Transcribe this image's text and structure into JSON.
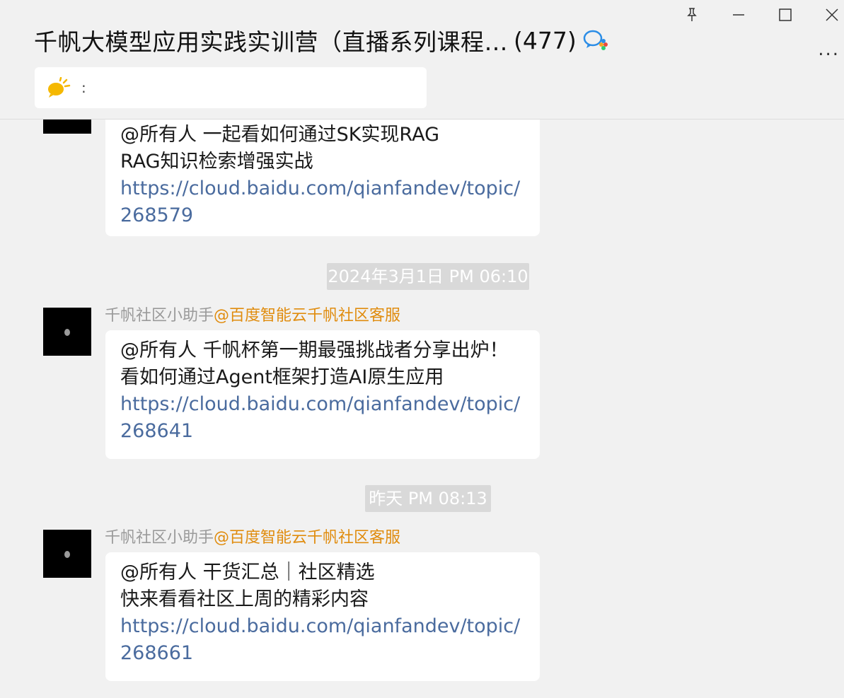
{
  "window": {
    "title": "千帆大模型应用实践实训营（直播系列课程…",
    "member_count": "(477)",
    "controls": [
      "pin-icon",
      "minimize-icon",
      "maximize-icon",
      "close-icon"
    ],
    "more_label": "..."
  },
  "notice": {
    "icon": "announcement-icon",
    "text": ":"
  },
  "messages": [
    {
      "lines": [
        "@所有人 一起看如何通过SK实现RAG",
        "RAG知识检索增强实战"
      ],
      "link": [
        "https://cloud.baidu.com/qianfandev/topic/",
        "268579"
      ]
    },
    {
      "timestamp": "2024年3月1日 PM 06:10",
      "sender": "千帆社区小助手",
      "sender_org": "@百度智能云千帆社区客服",
      "lines": [
        "@所有人 千帆杯第一期最强挑战者分享出炉！",
        "看如何通过Agent框架打造AI原生应用"
      ],
      "link": [
        "https://cloud.baidu.com/qianfandev/topic/",
        "268641"
      ]
    },
    {
      "timestamp": "昨天 PM 08:13",
      "sender": "千帆社区小助手",
      "sender_org": "@百度智能云千帆社区客服",
      "lines": [
        "@所有人 干货汇总｜社区精选",
        "快来看看社区上周的精彩内容"
      ],
      "link": [
        "https://cloud.baidu.com/qianfandev/topic/",
        "268661"
      ]
    }
  ],
  "colors": {
    "background": "#f1f1f1",
    "bubble": "#ffffff",
    "link": "#4a6b9e",
    "org_tag": "#e08c0e",
    "timestamp_bg": "#d9d9d9"
  }
}
